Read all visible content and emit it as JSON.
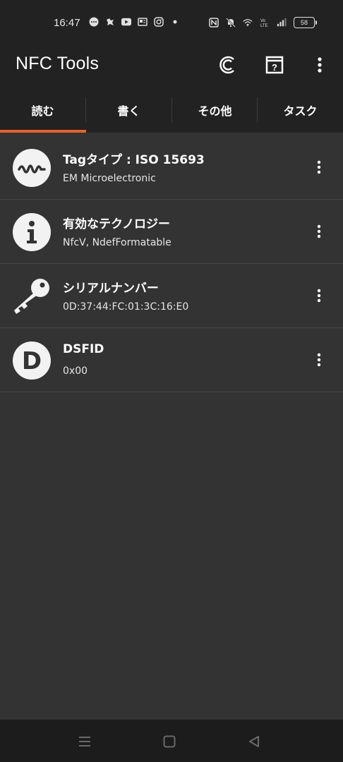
{
  "status_bar": {
    "time": "16:47",
    "battery": "58",
    "left_icons": [
      "messenger-icon",
      "bird-icon",
      "youtube-icon",
      "news-icon",
      "instagram-icon",
      "dot-icon"
    ],
    "right_icons": [
      "nfc-icon",
      "mute-icon",
      "wifi-icon",
      "volte-icon",
      "signal-icon",
      "battery-icon"
    ]
  },
  "app_bar": {
    "title": "NFC Tools",
    "actions": [
      "coin-icon",
      "help-icon",
      "more-vert-icon"
    ]
  },
  "tabs": [
    {
      "label": "読む",
      "selected": true
    },
    {
      "label": "書く",
      "selected": false
    },
    {
      "label": "その他",
      "selected": false
    },
    {
      "label": "タスク",
      "selected": false
    }
  ],
  "colors": {
    "accent": "#e8622a",
    "background": "#333333",
    "bar": "#222222"
  },
  "items": [
    {
      "icon": "wave-icon",
      "title": "Tagタイプ : ISO 15693",
      "subtitle": "EM Microelectronic"
    },
    {
      "icon": "info-icon",
      "title": "有効なテクノロジー",
      "subtitle": "NfcV, NdefFormatable"
    },
    {
      "icon": "key-icon",
      "title": "シリアルナンバー",
      "subtitle": "0D:37:44:FC:01:3C:16:E0"
    },
    {
      "icon": "d-letter-icon",
      "title": "DSFID",
      "subtitle": "0x00"
    }
  ],
  "nav_bar": [
    "menu-icon",
    "home-icon",
    "back-icon"
  ]
}
